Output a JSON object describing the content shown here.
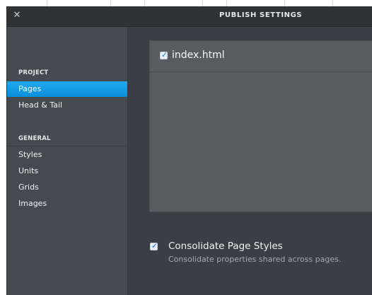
{
  "window": {
    "title": "PUBLISH SETTINGS",
    "close_glyph": "✕"
  },
  "sidebar": {
    "sections": [
      {
        "header": "PROJECT",
        "items": [
          {
            "label": "Pages",
            "active": true
          },
          {
            "label": "Head & Tail",
            "active": false
          }
        ]
      },
      {
        "header": "GENERAL",
        "items": [
          {
            "label": "Styles",
            "active": false
          },
          {
            "label": "Units",
            "active": false
          },
          {
            "label": "Grids",
            "active": false
          },
          {
            "label": "Images",
            "active": false
          }
        ]
      }
    ]
  },
  "pages": {
    "items": [
      {
        "name": "index.html",
        "checked": true,
        "check_glyph": "✓"
      }
    ]
  },
  "consolidate": {
    "title": "Consolidate Page Styles",
    "description": "Consolidate properties shared across pages.",
    "checked": true,
    "check_glyph": "✓"
  },
  "colors": {
    "accent": "#0c8fd9",
    "sidebar_bg": "#454a4e",
    "main_bg": "#3b3f43",
    "panel_bg": "#575c5f"
  },
  "icons": {
    "close": "close-icon",
    "checkbox": "checkbox-checked-icon"
  }
}
